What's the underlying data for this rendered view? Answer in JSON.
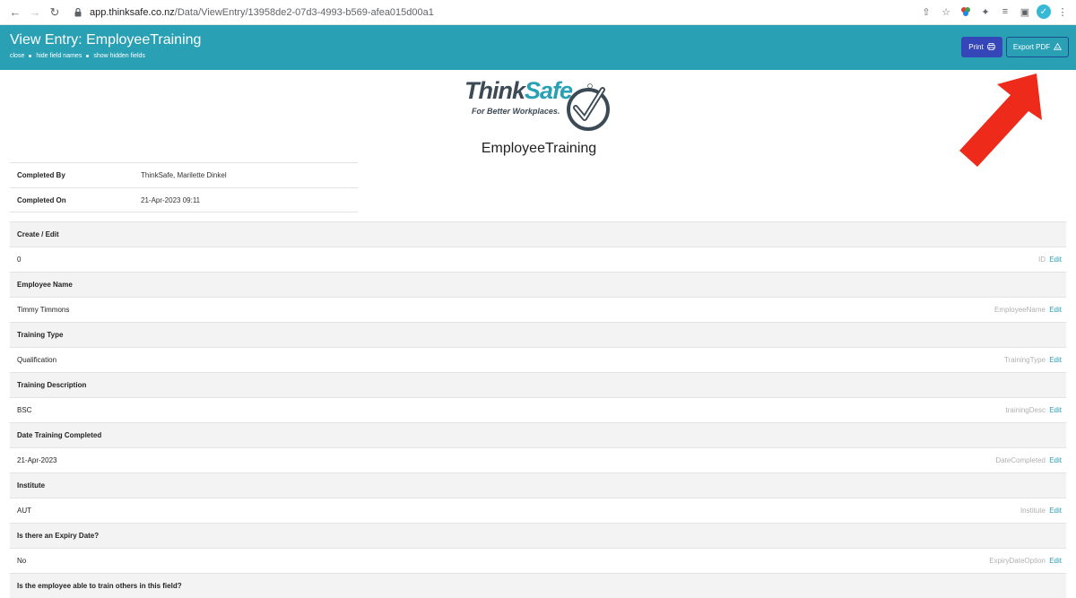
{
  "browser": {
    "url_host": "app.thinksafe.co.nz",
    "url_path": "/Data/ViewEntry/13958de2-07d3-4993-b569-afea015d00a1"
  },
  "header": {
    "title": "View Entry: EmployeeTraining",
    "links": [
      "close",
      "hide field names",
      "show hidden fields"
    ],
    "print_label": "Print",
    "export_label": "Export PDF",
    "bg_color": "#2aa0b5"
  },
  "logo": {
    "think": "Think",
    "safe": "Safe",
    "tagline": "For Better Workplaces."
  },
  "form_title": "EmployeeTraining",
  "meta": [
    {
      "label": "Completed By",
      "value": "ThinkSafe, Marilette Dinkel"
    },
    {
      "label": "Completed On",
      "value": "21-Apr-2023 09:11"
    }
  ],
  "fields": [
    {
      "label": "Create / Edit",
      "value": "0",
      "field_name": "ID",
      "edit": "Edit"
    },
    {
      "label": "Employee Name",
      "value": "Timmy Timmons",
      "field_name": "EmployeeName",
      "edit": "Edit"
    },
    {
      "label": "Training Type",
      "value": "Qualification",
      "field_name": "TrainingType",
      "edit": "Edit"
    },
    {
      "label": "Training Description",
      "value": "BSC",
      "field_name": "trainingDesc",
      "edit": "Edit"
    },
    {
      "label": "Date Training Completed",
      "value": "21-Apr-2023",
      "field_name": "DateCompleted",
      "edit": "Edit"
    },
    {
      "label": "Institute",
      "value": "AUT",
      "field_name": "Institute",
      "edit": "Edit"
    },
    {
      "label": "Is there an Expiry Date?",
      "value": "No",
      "field_name": "ExpiryDateOption",
      "edit": "Edit"
    },
    {
      "label": "Is the employee able to train others in this field?",
      "value": "",
      "field_name": "",
      "edit": ""
    }
  ],
  "colors": {
    "accent": "#2aa0b5",
    "print_button": "#3546b8",
    "annotation_arrow": "#ee2a1b"
  }
}
